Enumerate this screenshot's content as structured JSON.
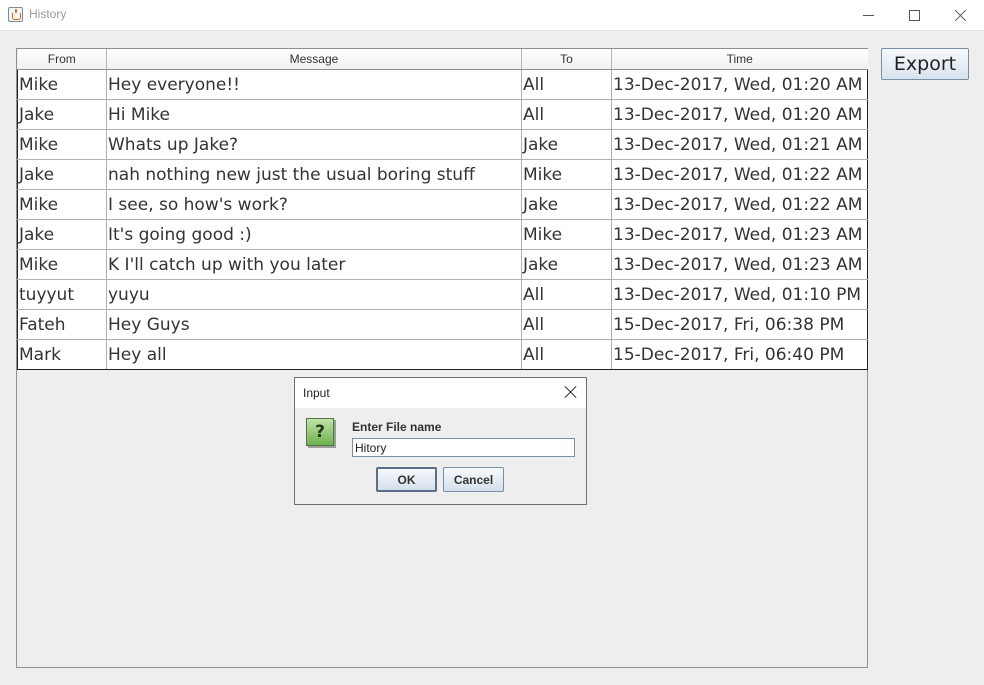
{
  "window": {
    "title": "History",
    "icon": "java-cup-icon"
  },
  "table": {
    "columns": [
      "From",
      "Message",
      "To",
      "Time"
    ],
    "rows": [
      [
        "Mike",
        "Hey everyone!!",
        "All",
        "13-Dec-2017, Wed, 01:20 AM"
      ],
      [
        "Jake",
        "Hi Mike",
        "All",
        "13-Dec-2017, Wed, 01:20 AM"
      ],
      [
        "Mike",
        "Whats up Jake?",
        "Jake",
        "13-Dec-2017, Wed, 01:21 AM"
      ],
      [
        "Jake",
        "nah nothing new just the usual boring stuff",
        "Mike",
        "13-Dec-2017, Wed, 01:22 AM"
      ],
      [
        "Mike",
        "I see, so how's work?",
        "Jake",
        "13-Dec-2017, Wed, 01:22 AM"
      ],
      [
        "Jake",
        "It's going good :)",
        "Mike",
        "13-Dec-2017, Wed, 01:23 AM"
      ],
      [
        "Mike",
        "K I'll catch up with you later",
        "Jake",
        "13-Dec-2017, Wed, 01:23 AM"
      ],
      [
        "tuyyut",
        "yuyu",
        "All",
        "13-Dec-2017, Wed, 01:10 PM"
      ],
      [
        "Fateh",
        "Hey Guys",
        "All",
        "15-Dec-2017, Fri, 06:38 PM"
      ],
      [
        "Mark",
        "Hey all",
        "All",
        "15-Dec-2017, Fri, 06:40 PM"
      ]
    ]
  },
  "export_button": {
    "label": "Export"
  },
  "dialog": {
    "title": "Input",
    "icon_glyph": "?",
    "prompt": "Enter File name",
    "input_value": "Hitory",
    "ok_label": "OK",
    "cancel_label": "Cancel"
  }
}
